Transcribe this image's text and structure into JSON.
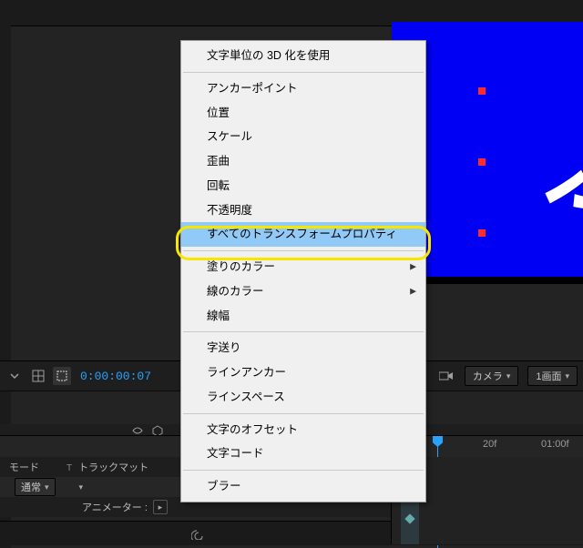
{
  "preview": {
    "text": "ぶ"
  },
  "toolbar": {
    "timecode": "0:00:00:07",
    "camera_label": "カメラ",
    "view_count_label": "1画面"
  },
  "time_ruler": {
    "ticks": [
      "20f",
      "01:00f"
    ]
  },
  "columns": {
    "mode_label": "モード",
    "trackmatte_prefix": "T",
    "trackmatte_label": "トラックマット"
  },
  "layer": {
    "mode_value": "通常"
  },
  "animator": {
    "label": "アニメーター :"
  },
  "menu": {
    "enable_3d": "文字単位の 3D 化を使用",
    "anchor_point": "アンカーポイント",
    "position": "位置",
    "scale": "スケール",
    "skew": "歪曲",
    "rotation": "回転",
    "opacity": "不透明度",
    "all_transform": "すべてのトランスフォームプロパティ",
    "fill_color": "塗りのカラー",
    "stroke_color": "線のカラー",
    "stroke_width": "線幅",
    "tracking": "字送り",
    "line_anchor": "ラインアンカー",
    "line_spacing": "ラインスペース",
    "char_offset": "文字のオフセット",
    "char_value": "文字コード",
    "blur": "ブラー"
  }
}
